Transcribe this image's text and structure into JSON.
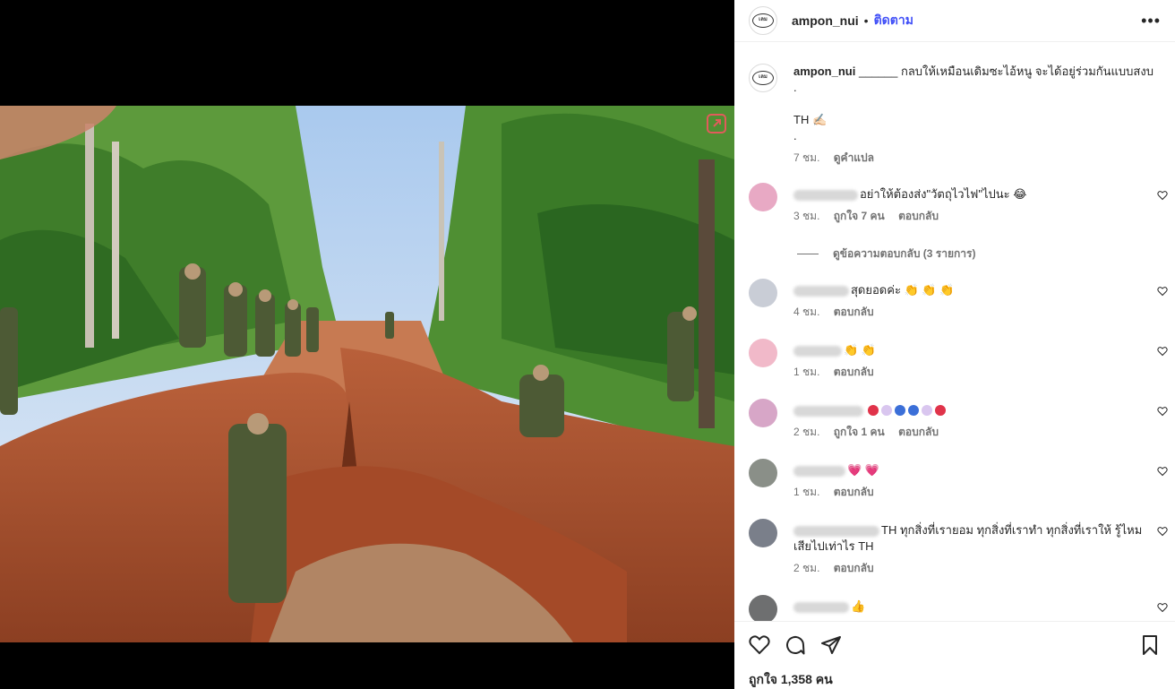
{
  "post": {
    "username": "ampon_nui",
    "separator": "•",
    "follow_label": "ติดตาม",
    "more_label": "•••",
    "avatar_text": "เลม"
  },
  "caption": {
    "username": "ampon_nui",
    "text": "______ กลบให้เหมือนเดิมซะไอ้หนู จะได้อยู่ร่วมกันแบบสงบ",
    "line2": ".",
    "line3": "TH ✍🏻",
    "line4": ".",
    "time": "7 ชม.",
    "translate": "ดูคำแปล"
  },
  "comments": [
    {
      "text": "อย่าให้ต้องส่ง\"วัตถุไวไฟ\"ไปนะ 😂",
      "time": "3 ชม.",
      "likes": "ถูกใจ 7 คน",
      "reply": "ตอบกลับ",
      "avatar_color": "#e8a9c4"
    },
    {
      "text": "สุดยอดค่ะ 👏 👏 👏",
      "time": "4 ชม.",
      "likes": "",
      "reply": "ตอบกลับ",
      "avatar_color": "#c9cdd6"
    },
    {
      "text": "👏 👏",
      "time": "1 ชม.",
      "likes": "",
      "reply": "ตอบกลับ",
      "avatar_color": "#f1b9c9"
    },
    {
      "text": "",
      "time": "2 ชม.",
      "likes": "ถูกใจ 1 คน",
      "reply": "ตอบกลับ",
      "avatar_color": "#d7a6c7"
    },
    {
      "text": "💗 💗",
      "time": "1 ชม.",
      "likes": "",
      "reply": "ตอบกลับ",
      "avatar_color": "#8a8f88"
    },
    {
      "text": "TH ทุกสิ่งที่เรายอม ทุกสิ่งที่เราทำ ทุกสิ่งที่เราให้ รู้ไหมเสียไปเท่าไร TH",
      "time": "2 ชม.",
      "likes": "",
      "reply": "ตอบกลับ",
      "avatar_color": "#7a7f8a"
    },
    {
      "text": "👍",
      "time": "",
      "likes": "",
      "reply": "",
      "avatar_color": "#6e6f70"
    }
  ],
  "view_replies": "ดูข้อความตอบกลับ (3 รายการ)",
  "emoji_colors": [
    "#e0334a",
    "#d9c6ef",
    "#3b6fd8",
    "#3b6fd8",
    "#d9c6ef",
    "#e0334a"
  ],
  "footer": {
    "likes_text": "ถูกใจ 1,358 คน"
  }
}
